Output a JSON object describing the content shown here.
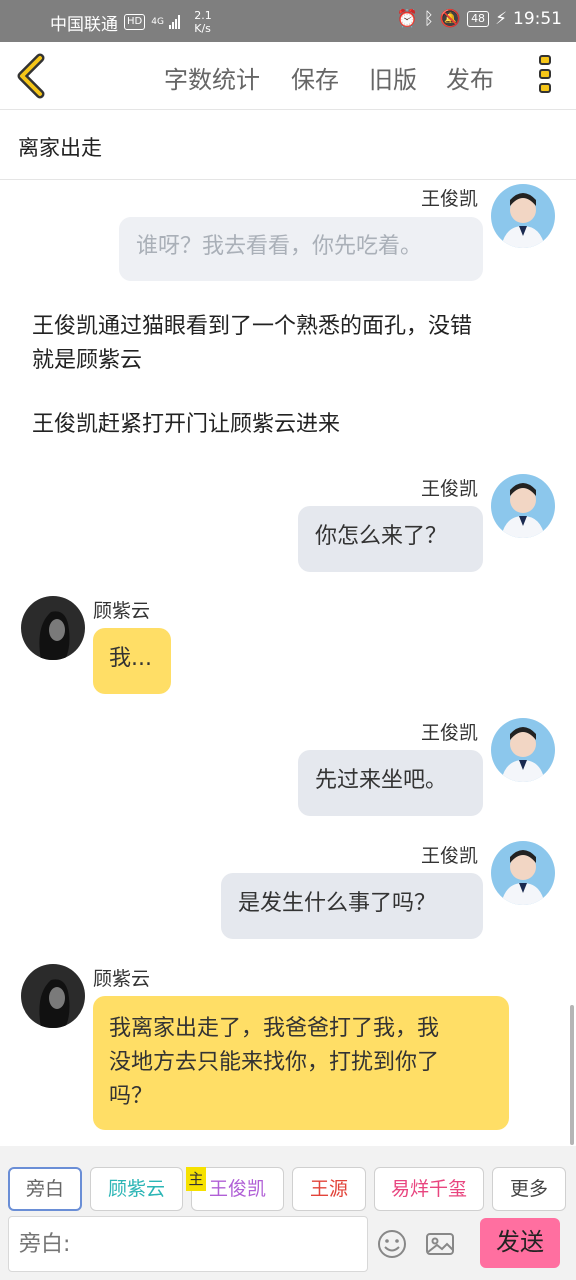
{
  "status_bar": {
    "carrier": "中国联通",
    "hd": "HD",
    "network": "4G",
    "speed_value": "2.1",
    "speed_unit": "K/s",
    "battery": "48",
    "time": "19:51"
  },
  "toolbar": {
    "word_count": "字数统计",
    "save": "保存",
    "old_version": "旧版",
    "publish": "发布"
  },
  "story_title": "离家出走",
  "messages": [
    {
      "speaker": "王俊凯",
      "text": "谁呀？我去看看，你先吃着。"
    },
    {
      "narration_1": "王俊凯通过猫眼看到了一个熟悉的面孔，没错",
      "narration_2": "就是顾紫云",
      "narration_3": "王俊凯赶紧打开门让顾紫云进来"
    },
    {
      "speaker": "王俊凯",
      "text": "你怎么来了？"
    },
    {
      "speaker": "顾紫云",
      "text": "我..."
    },
    {
      "speaker": "王俊凯",
      "text": "先过来坐吧。"
    },
    {
      "speaker": "王俊凯",
      "text": "是发生什么事了吗？"
    },
    {
      "speaker": "顾紫云",
      "line1": "我离家出走了，我爸爸打了我，我",
      "line2": "没地方去只能来找你，打扰到你了",
      "line3": "吗？"
    }
  ],
  "roles": {
    "narrator": "旁白",
    "role1": "顾紫云",
    "main_badge": "主",
    "role2": "王俊凯",
    "role3": "王源",
    "role4": "易烊千玺",
    "more": "更多"
  },
  "input": {
    "placeholder": "旁白:",
    "send": "发送"
  },
  "colors": {
    "accent_yellow": "#f5c518",
    "bubble_yellow": "#ffde66",
    "send_pink": "#ff6fa0",
    "role1_color": "#2bb5b5",
    "role2_color": "#b05fd6",
    "role3_color": "#e2443a",
    "role4_color": "#e8457f"
  }
}
